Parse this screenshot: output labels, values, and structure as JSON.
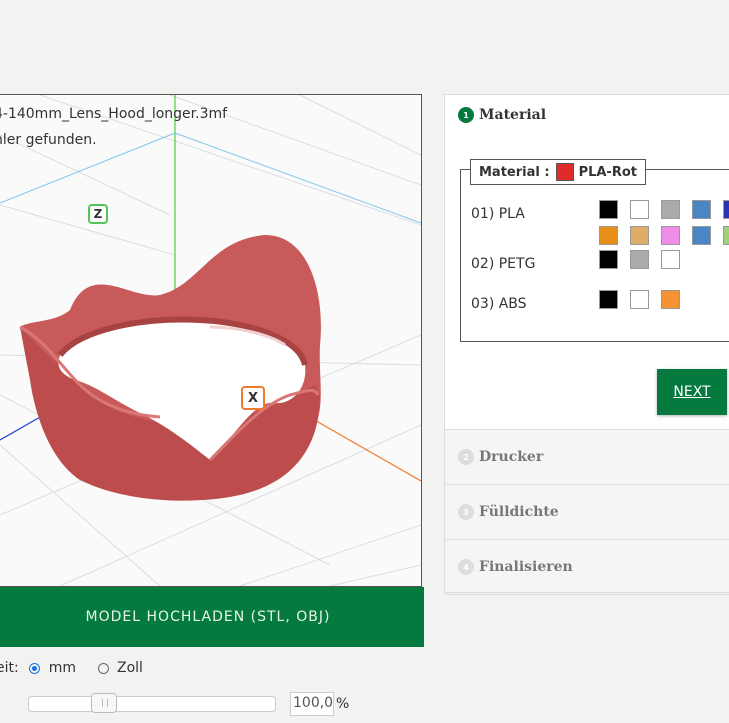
{
  "viewer": {
    "file_name": "4-140mm_Lens_Hood_longer.3mf",
    "status": "hler gefunden.",
    "axis_z": "Z",
    "axis_x": "X"
  },
  "upload_button": "MODEL HOCHLADEN (STL, OBJ)",
  "units": {
    "label": "eit:",
    "option_mm": "mm",
    "option_zoll": "Zoll",
    "selected": "mm"
  },
  "zoom": {
    "value": "100,0",
    "suffix": "%",
    "slider_level": 0.28
  },
  "accordion": {
    "steps": [
      {
        "number": "1",
        "title": "Material",
        "open": true
      },
      {
        "number": "2",
        "title": "Drucker",
        "open": false
      },
      {
        "number": "3",
        "title": "Fülldichte",
        "open": false
      },
      {
        "number": "4",
        "title": "Finalisieren",
        "open": false
      }
    ],
    "material_legend_label": "Material :",
    "selected_material": "PLA-Rot",
    "selected_color": "#e02b2b",
    "materials": [
      {
        "label": "01) PLA",
        "colors": [
          "#000000",
          "#ffffff",
          "#aaaaaa",
          "#4a86c5",
          "#2836b5",
          "#e88f1a",
          "#dfae66",
          "#ee8ee8",
          "#4a86c5",
          "#9fd07a"
        ]
      },
      {
        "label": "02) PETG",
        "colors": [
          "#000000",
          "#aaaaaa",
          "#ffffff"
        ]
      },
      {
        "label": "03) ABS",
        "colors": [
          "#000000",
          "#ffffff",
          "#f59235"
        ]
      }
    ],
    "next_label": "NEXT"
  }
}
